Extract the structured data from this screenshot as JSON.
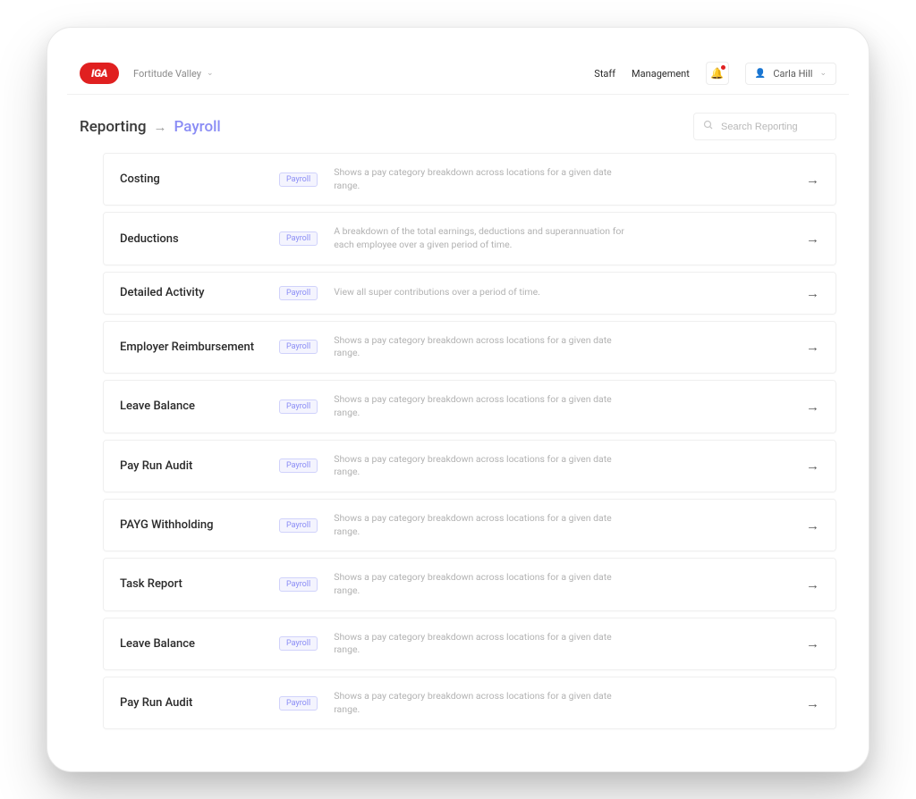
{
  "header": {
    "logo_text": "IGA",
    "location": "Fortitude Valley",
    "nav": {
      "staff": "Staff",
      "management": "Management"
    },
    "user_name": "Carla Hill"
  },
  "breadcrumb": {
    "parent": "Reporting",
    "current": "Payroll"
  },
  "search": {
    "placeholder": "Search Reporting"
  },
  "badge_label": "Payroll",
  "reports": [
    {
      "title": "Costing",
      "desc": "Shows a pay category breakdown across locations for a given date range."
    },
    {
      "title": "Deductions",
      "desc": "A breakdown of the total earnings, deductions and superannuation for each employee over a given period of time."
    },
    {
      "title": "Detailed Activity",
      "desc": "View all super contributions over a period of time."
    },
    {
      "title": "Employer Reimbursement",
      "desc": "Shows a pay category breakdown across locations for a given date range."
    },
    {
      "title": "Leave Balance",
      "desc": "Shows a pay category breakdown across locations for a given date range."
    },
    {
      "title": "Pay Run Audit",
      "desc": "Shows a pay category breakdown across locations for a given date range."
    },
    {
      "title": "PAYG Withholding",
      "desc": "Shows a pay category breakdown across locations for a given date range."
    },
    {
      "title": "Task Report",
      "desc": "Shows a pay category breakdown across locations for a given date range."
    },
    {
      "title": "Leave Balance",
      "desc": "Shows a pay category breakdown across locations for a given date range."
    },
    {
      "title": "Pay Run Audit",
      "desc": "Shows a pay category breakdown across locations for a given date range."
    }
  ]
}
